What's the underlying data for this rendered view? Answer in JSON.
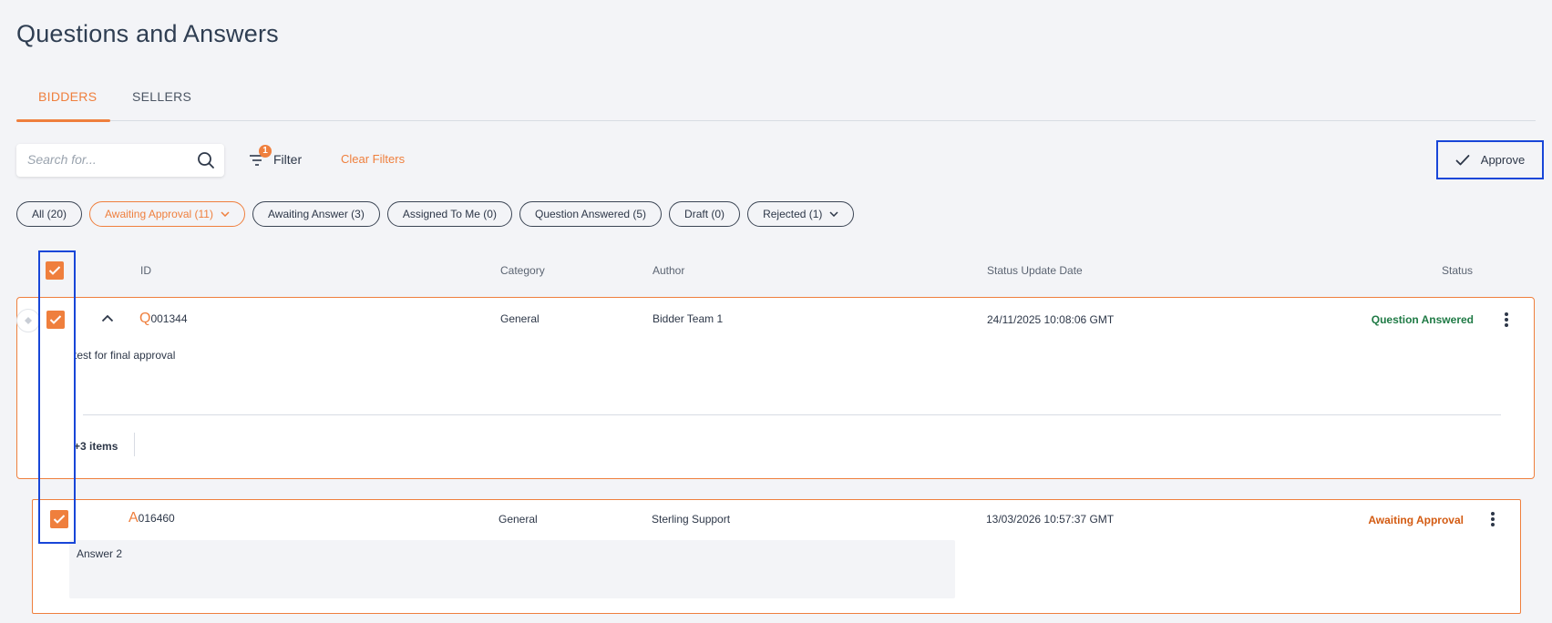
{
  "page": {
    "title": "Questions and Answers"
  },
  "tabs": [
    {
      "label": "BIDDERS",
      "active": true
    },
    {
      "label": "SELLERS",
      "active": false
    }
  ],
  "toolbar": {
    "search_placeholder": "Search for...",
    "filter_label": "Filter",
    "filter_count": "1",
    "clear_filters_label": "Clear Filters",
    "approve_label": "Approve"
  },
  "chips": [
    {
      "label": "All (20)"
    },
    {
      "label": "Awaiting Approval (11)",
      "active": true,
      "dropdown": true
    },
    {
      "label": "Awaiting Answer (3)"
    },
    {
      "label": "Assigned To Me (0)"
    },
    {
      "label": "Question Answered (5)"
    },
    {
      "label": "Draft (0)"
    },
    {
      "label": "Rejected (1)",
      "dropdown": true
    }
  ],
  "table": {
    "headers": {
      "id": "ID",
      "category": "Category",
      "author": "Author",
      "status_update_date": "Status Update Date",
      "status": "Status"
    },
    "question": {
      "prefix": "Q",
      "number": "001344",
      "category": "General",
      "author": "Bidder Team 1",
      "date": "24/11/2025 10:08:06 GMT",
      "status": "Question Answered",
      "body": "test for final approval",
      "more_items": "+3 items"
    },
    "answer": {
      "prefix": "A",
      "number": "016460",
      "category": "General",
      "author": "Sterling Support",
      "date": "13/03/2026 10:57:37 GMT",
      "status": "Awaiting Approval",
      "body": "Answer 2"
    }
  },
  "colors": {
    "accent": "#ef7f3d",
    "highlight": "#1846d8",
    "status_answered": "#1f7a45",
    "status_awaiting": "#d35b12"
  }
}
